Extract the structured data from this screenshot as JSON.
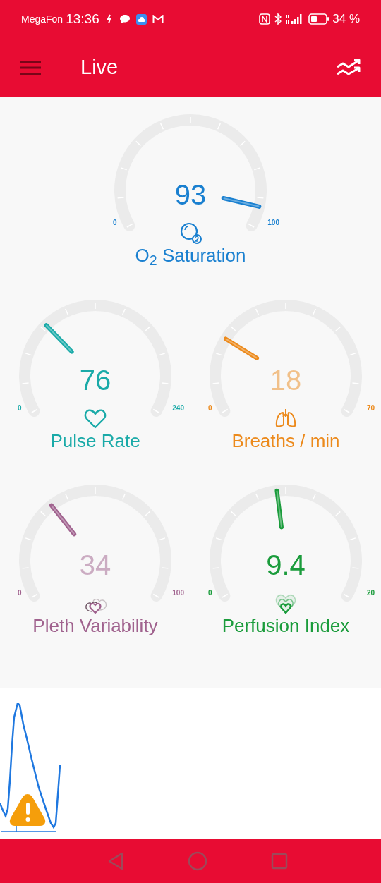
{
  "status_bar": {
    "carrier": "MegaFon",
    "time": "13:36",
    "battery": "34 %"
  },
  "app_bar": {
    "title": "Live"
  },
  "gauges": [
    {
      "kind": "o2",
      "label": "O$_{2}$ Saturation",
      "value": "93",
      "min": "0",
      "max": "100",
      "color": "#1a80d0"
    },
    {
      "kind": "pulse",
      "label": "Pulse Rate",
      "value": "76",
      "min": "0",
      "max": "240",
      "color": "#1aaaa8"
    },
    {
      "kind": "breaths",
      "label": "Breaths / min",
      "value": "18",
      "min": "0",
      "max": "70",
      "color": "#ec8a1c"
    },
    {
      "kind": "pleth",
      "label": "Pleth Variability",
      "value": "34",
      "min": "0",
      "max": "100",
      "color": "#a0628e"
    },
    {
      "kind": "perfusion",
      "label": "Perfusion Index",
      "value": "9.4",
      "min": "0",
      "max": "20",
      "color": "#1b9c3c"
    }
  ]
}
